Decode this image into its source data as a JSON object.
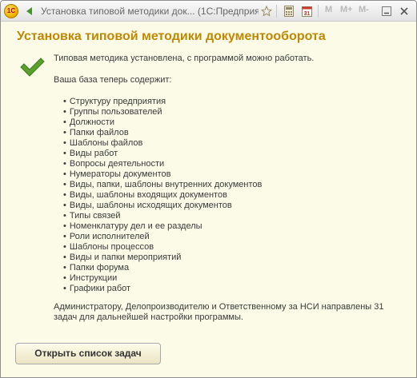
{
  "window": {
    "title": "Установка типовой методики док...   (1С:Предприятие)",
    "logo_text": "1С",
    "memory_buttons": [
      "M",
      "M+",
      "M-"
    ]
  },
  "content": {
    "heading": "Установка типовой методики документооборота",
    "intro": "Типовая методика установлена, с программой можно работать.",
    "subhead": "Ваша база теперь содержит:",
    "bullet": "•",
    "items": [
      "Структуру предприятия",
      "Группы пользователей",
      "Должности",
      "Папки файлов",
      "Шаблоны файлов",
      "Виды работ",
      "Вопросы деятельности",
      "Нумераторы документов",
      "Виды, папки, шаблоны внутренних документов",
      "Виды, шаблоны входящих документов",
      "Виды, шаблоны исходящих документов",
      "Типы связей",
      "Номенклатуру дел и ее разделы",
      "Роли исполнителей",
      "Шаблоны процессов",
      "Виды и папки мероприятий",
      "Папки форума",
      "Инструкции",
      "Графики работ"
    ],
    "footer": "Администратору, Делопроизводителю и Ответственному за НСИ направлены 31 задач для дальнейшей настройки программы."
  },
  "actions": {
    "open_tasks_label": "Открыть список задач"
  },
  "colors": {
    "heading": "#c08800",
    "check": "#5aa02c",
    "background": "#fbfbe8"
  }
}
